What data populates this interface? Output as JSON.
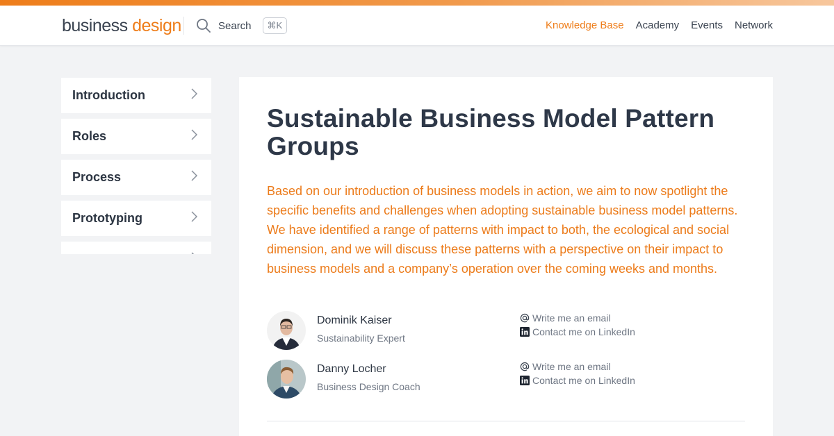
{
  "brand": {
    "word1": "business",
    "word2": "design",
    "accent_color": "#ee7d1a"
  },
  "header": {
    "search_label": "Search",
    "search_shortcut": "⌘K",
    "nav": [
      {
        "label": "Knowledge Base",
        "active": true
      },
      {
        "label": "Academy",
        "active": false
      },
      {
        "label": "Events",
        "active": false
      },
      {
        "label": "Network",
        "active": false
      }
    ]
  },
  "sidebar": {
    "items": [
      {
        "label": "Introduction",
        "icon": "chevron-right-icon"
      },
      {
        "label": "Roles",
        "icon": "chevron-right-icon"
      },
      {
        "label": "Process",
        "icon": "chevron-right-icon"
      },
      {
        "label": "Prototyping",
        "icon": "chevron-right-icon"
      },
      {
        "label": "",
        "icon": "chevron-right-icon"
      }
    ]
  },
  "article": {
    "title": "Sustainable Business Model Pattern Groups",
    "intro": "Based on our introduction of business models in action, we aim to now spotlight the specific benefits and challenges when adopting sustainable business model patterns. We have identified a range of patterns with impact to both, the ecological and social dimension, and we will discuss these patterns with a perspective on their impact to business models and a company’s operation over the coming weeks and months.",
    "authors": [
      {
        "name": "Dominik Kaiser",
        "role": "Sustainability Expert",
        "email_label": "Write me an email",
        "linkedin_label": "Contact me on LinkedIn"
      },
      {
        "name": "Danny Locher",
        "role": "Business Design Coach",
        "email_label": "Write me an email",
        "linkedin_label": "Contact me on LinkedIn"
      }
    ]
  }
}
